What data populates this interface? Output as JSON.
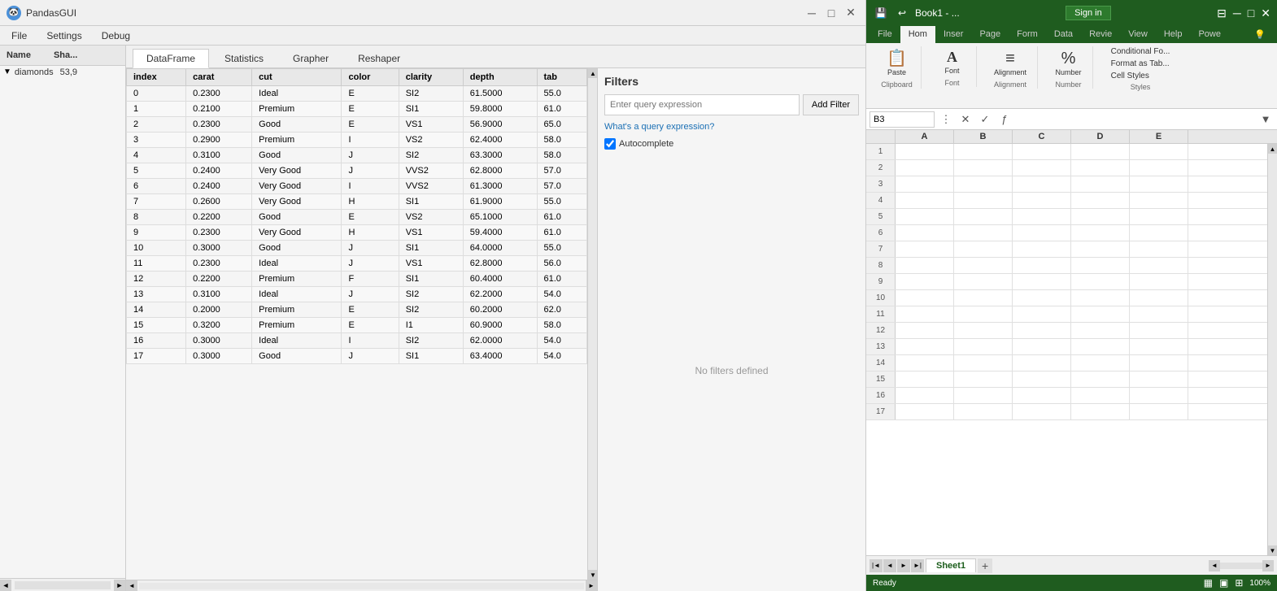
{
  "pandas": {
    "title": "PandasGUI",
    "menu": [
      "File",
      "Settings",
      "Debug"
    ],
    "sidebar": {
      "col_name": "Name",
      "col_shape": "Sha...",
      "rows": [
        {
          "name": "diamonds",
          "shape": "53,9"
        }
      ]
    },
    "tabs": [
      "DataFrame",
      "Statistics",
      "Grapher",
      "Reshaper"
    ],
    "active_tab": "DataFrame",
    "table": {
      "columns": [
        "index",
        "carat",
        "cut",
        "color",
        "clarity",
        "depth",
        "tab"
      ],
      "rows": [
        [
          "0",
          "0.2300",
          "Ideal",
          "E",
          "SI2",
          "61.5000",
          "55.0"
        ],
        [
          "1",
          "0.2100",
          "Premium",
          "E",
          "SI1",
          "59.8000",
          "61.0"
        ],
        [
          "2",
          "0.2300",
          "Good",
          "E",
          "VS1",
          "56.9000",
          "65.0"
        ],
        [
          "3",
          "0.2900",
          "Premium",
          "I",
          "VS2",
          "62.4000",
          "58.0"
        ],
        [
          "4",
          "0.3100",
          "Good",
          "J",
          "SI2",
          "63.3000",
          "58.0"
        ],
        [
          "5",
          "0.2400",
          "Very Good",
          "J",
          "VVS2",
          "62.8000",
          "57.0"
        ],
        [
          "6",
          "0.2400",
          "Very Good",
          "I",
          "VVS2",
          "61.3000",
          "57.0"
        ],
        [
          "7",
          "0.2600",
          "Very Good",
          "H",
          "SI1",
          "61.9000",
          "55.0"
        ],
        [
          "8",
          "0.2200",
          "Good",
          "E",
          "VS2",
          "65.1000",
          "61.0"
        ],
        [
          "9",
          "0.2300",
          "Very Good",
          "H",
          "VS1",
          "59.4000",
          "61.0"
        ],
        [
          "10",
          "0.3000",
          "Good",
          "J",
          "SI1",
          "64.0000",
          "55.0"
        ],
        [
          "11",
          "0.2300",
          "Ideal",
          "J",
          "VS1",
          "62.8000",
          "56.0"
        ],
        [
          "12",
          "0.2200",
          "Premium",
          "F",
          "SI1",
          "60.4000",
          "61.0"
        ],
        [
          "13",
          "0.3100",
          "Ideal",
          "J",
          "SI2",
          "62.2000",
          "54.0"
        ],
        [
          "14",
          "0.2000",
          "Premium",
          "E",
          "SI2",
          "60.2000",
          "62.0"
        ],
        [
          "15",
          "0.3200",
          "Premium",
          "E",
          "I1",
          "60.9000",
          "58.0"
        ],
        [
          "16",
          "0.3000",
          "Ideal",
          "I",
          "SI2",
          "62.0000",
          "54.0"
        ],
        [
          "17",
          "0.3000",
          "Good",
          "J",
          "SI1",
          "63.4000",
          "54.0"
        ]
      ]
    },
    "filters": {
      "title": "Filters",
      "input_placeholder": "Enter query expression",
      "add_button": "Add Filter",
      "query_link": "What's a query expression?",
      "autocomplete_label": "Autocomplete",
      "no_filters_text": "No filters defined"
    }
  },
  "excel": {
    "title": "Book1 - ...",
    "sign_in": "Sign in",
    "tabs": [
      "File",
      "Hom",
      "Inser",
      "Page",
      "Form",
      "Data",
      "Revie",
      "View",
      "Help",
      "Powe"
    ],
    "active_tab": "Hom",
    "ribbon": {
      "clipboard": {
        "label": "Clipboard",
        "main_icon": "📋",
        "main_label": "Paste"
      },
      "font": {
        "label": "Font",
        "main_icon": "A",
        "main_label": "Font"
      },
      "alignment": {
        "label": "Alignment",
        "main_icon": "≡",
        "main_label": "Alignment"
      },
      "number": {
        "label": "Number",
        "main_icon": "%",
        "main_label": "Number"
      },
      "styles": {
        "label": "Styles",
        "items": [
          "Conditional Fo...",
          "Format as Tab...",
          "Cell Styles"
        ]
      }
    },
    "formula_bar": {
      "cell_ref": "B3",
      "formula": ""
    },
    "sheet": {
      "cols": [
        "A",
        "B",
        "C",
        "D",
        "E"
      ],
      "rows": [
        1,
        2,
        3,
        4,
        5,
        6,
        7,
        8,
        9,
        10,
        11,
        12,
        13,
        14,
        15,
        16,
        17
      ]
    },
    "sheet_tabs": [
      "Sheet1"
    ],
    "status": {
      "ready": "Ready",
      "zoom": "100%"
    }
  }
}
